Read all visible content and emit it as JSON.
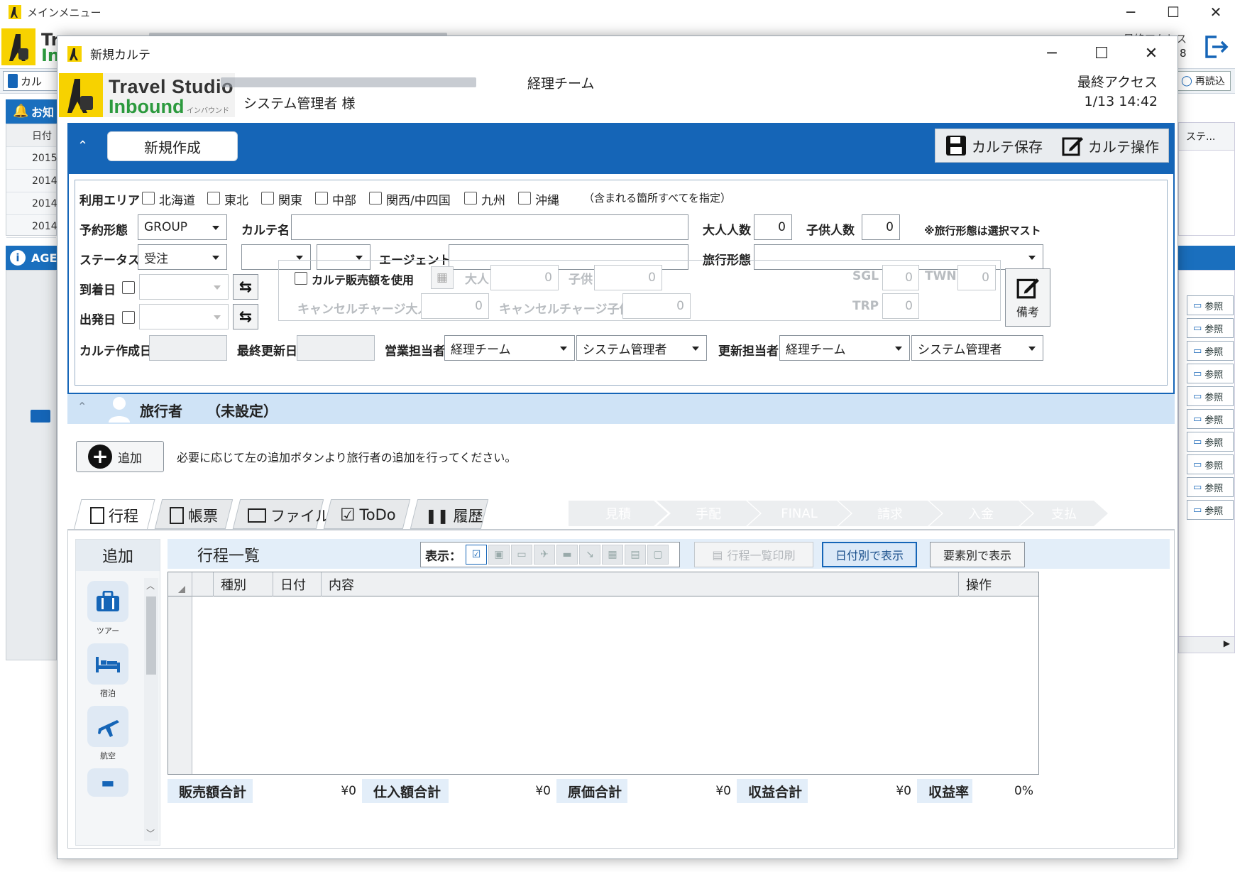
{
  "main_window": {
    "title": "メインメニュー",
    "header_brand_1": "Tr",
    "header_brand_2": "In",
    "right_label": "最終アクセス",
    "right_num": "8",
    "toolbar_tab": "カル",
    "reload_label": "再読込",
    "notice_header": "お知",
    "agent_header": "AGE",
    "grid_col_date": "日付",
    "grid_rows": [
      "2015/",
      "2014/",
      "2014/",
      "2014/"
    ],
    "right_col_header": "ステ...",
    "side_buttons": [
      "参照",
      "参照",
      "参照",
      "参照",
      "参照",
      "参照",
      "参照",
      "参照",
      "参照",
      "参照"
    ]
  },
  "dialog": {
    "title": "新規カルテ",
    "brand_line1": "Travel Studio",
    "brand_line2": "Inbound",
    "brand_sub": "インバウンド",
    "team": "経理チーム",
    "user": "システム管理者 様",
    "last_access_label": "最終アクセス",
    "last_access_value": "1/13 14:42",
    "tab_new": "新規作成",
    "btn_save": "カルテ保存",
    "btn_ops": "カルテ操作"
  },
  "form": {
    "area_label": "利用エリア",
    "areas": [
      "北海道",
      "東北",
      "関東",
      "中部",
      "関西/中四国",
      "九州",
      "沖縄"
    ],
    "area_note": "（含まれる箇所すべてを指定）",
    "booking_label": "予約形態",
    "booking_value": "GROUP",
    "karte_name_label": "カルテ名",
    "karte_name_value": "",
    "adults_label": "大人人数",
    "adults_value": "0",
    "children_label": "子供人数",
    "children_value": "0",
    "travel_note": "※旅行形態は選択マスト",
    "status_label": "ステータス",
    "status_value": "受注",
    "sub1_value": "",
    "sub2_value": "",
    "agent_label": "エージェント",
    "agent_value": "",
    "travel_type_label": "旅行形態",
    "travel_type_value": "",
    "arrival_label": "到着日",
    "departure_label": "出発日",
    "use_sales_label": "カルテ販売額を使用",
    "adult_label": "大人",
    "adult_value": "0",
    "child_label": "子供",
    "child_value": "0",
    "sgl_label": "SGL",
    "sgl_value": "0",
    "twn_label": "TWN",
    "twn_value": "0",
    "trp_label": "TRP",
    "trp_value": "0",
    "cancel_adult_label": "キャンセルチャージ大人",
    "cancel_adult_value": "0",
    "cancel_child_label": "キャンセルチャージ子供",
    "cancel_child_value": "0",
    "memo_label": "備考",
    "created_label": "カルテ作成日",
    "created_value": "",
    "updated_label": "最終更新日",
    "updated_value": "",
    "sales_rep_label": "営業担当者",
    "sales_team": "経理チーム",
    "sales_user": "システム管理者",
    "update_rep_label": "更新担当者",
    "update_team": "経理チーム",
    "update_user": "システム管理者"
  },
  "traveler": {
    "title": "旅行者",
    "status": "（未設定）",
    "add_label": "追加",
    "message": "必要に応じて左の追加ボタンより旅行者の追加を行ってください。"
  },
  "tabs": [
    "行程",
    "帳票",
    "ファイル",
    "ToDo",
    "履歴"
  ],
  "steps": [
    "見積",
    "手配",
    "FINAL",
    "請求",
    "入金",
    "支払"
  ],
  "itinerary": {
    "add_header": "追加",
    "add_items": [
      "ツアー",
      "宿泊",
      "航空"
    ],
    "list_title": "行程一覧",
    "filter_label": "表示：",
    "print_label": "行程一覧印刷",
    "by_date_label": "日付別で表示",
    "by_element_label": "要素別で表示",
    "columns": [
      "種別",
      "日付",
      "内容",
      "操作"
    ],
    "totals": [
      {
        "label": "販売額合計",
        "value": "¥0"
      },
      {
        "label": "仕入額合計",
        "value": "¥0"
      },
      {
        "label": "原価合計",
        "value": "¥0"
      },
      {
        "label": "収益合計",
        "value": "¥0"
      },
      {
        "label": "収益率",
        "value": "0%"
      }
    ]
  },
  "colors": {
    "accent": "#1565b7",
    "brand_yellow": "#f7d200",
    "brand_green": "#2c9a3e"
  }
}
